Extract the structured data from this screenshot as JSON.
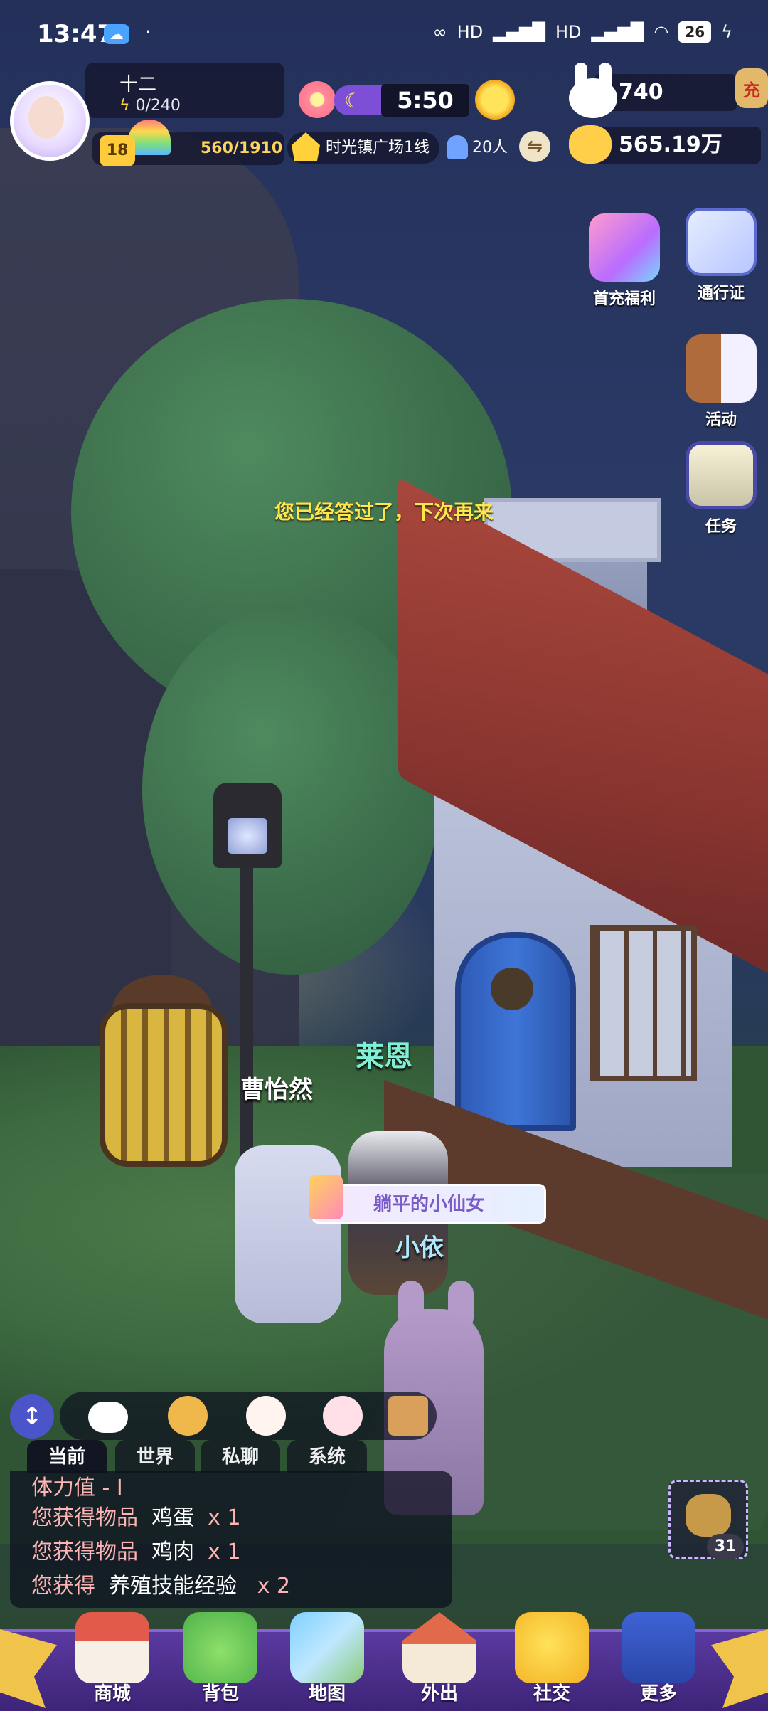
{
  "status_bar": {
    "time": "13:47",
    "dot": "·",
    "net1": "HD",
    "net2": "HD",
    "battery": "26"
  },
  "player": {
    "name": "十二",
    "stamina": "0/240",
    "level": "18",
    "xp": "560/1910"
  },
  "world": {
    "clock": "5:50",
    "location": "时光镇广场1线",
    "online": "20人"
  },
  "currency": {
    "bunny_amount": "740",
    "recharge_label": "充",
    "bear_amount": "565.19万"
  },
  "side_buttons": {
    "first_recharge": "首充福利",
    "pass": "通行证",
    "event": "活动",
    "task": "任务"
  },
  "toast": "您已经答过了，下次再来",
  "npcs": {
    "lain": "莱恩",
    "cao": "曹怡然"
  },
  "player_title": "躺平的小仙女",
  "player_name": "小依",
  "chat": {
    "toggle_symbol": "↕",
    "tabs": [
      "当前",
      "世界",
      "私聊",
      "系统"
    ],
    "lines": [
      {
        "prefix": "体力值 - I",
        "item": "",
        "qty": ""
      },
      {
        "prefix": "您获得物品",
        "item": "鸡蛋",
        "qty": "x 1"
      },
      {
        "prefix": "您获得物品",
        "item": "鸡肉",
        "qty": "x 1"
      },
      {
        "prefix": "您获得",
        "item": "养殖技能经验",
        "qty": "x 2"
      }
    ]
  },
  "quick_bag_count": "31",
  "nav": {
    "shop": "商城",
    "bag": "背包",
    "map": "地图",
    "outing": "外出",
    "social": "社交",
    "more": "更多"
  },
  "icons": {
    "status_cloud": "cloud-icon",
    "stamina": "lightning-icon",
    "time_of_day": "moon-icon",
    "weather": "sun-icon",
    "location": "house-icon",
    "online": "person-icon",
    "swap": "swap-icon",
    "bunny_currency": "bunny-icon",
    "bear_currency": "bear-icon"
  }
}
